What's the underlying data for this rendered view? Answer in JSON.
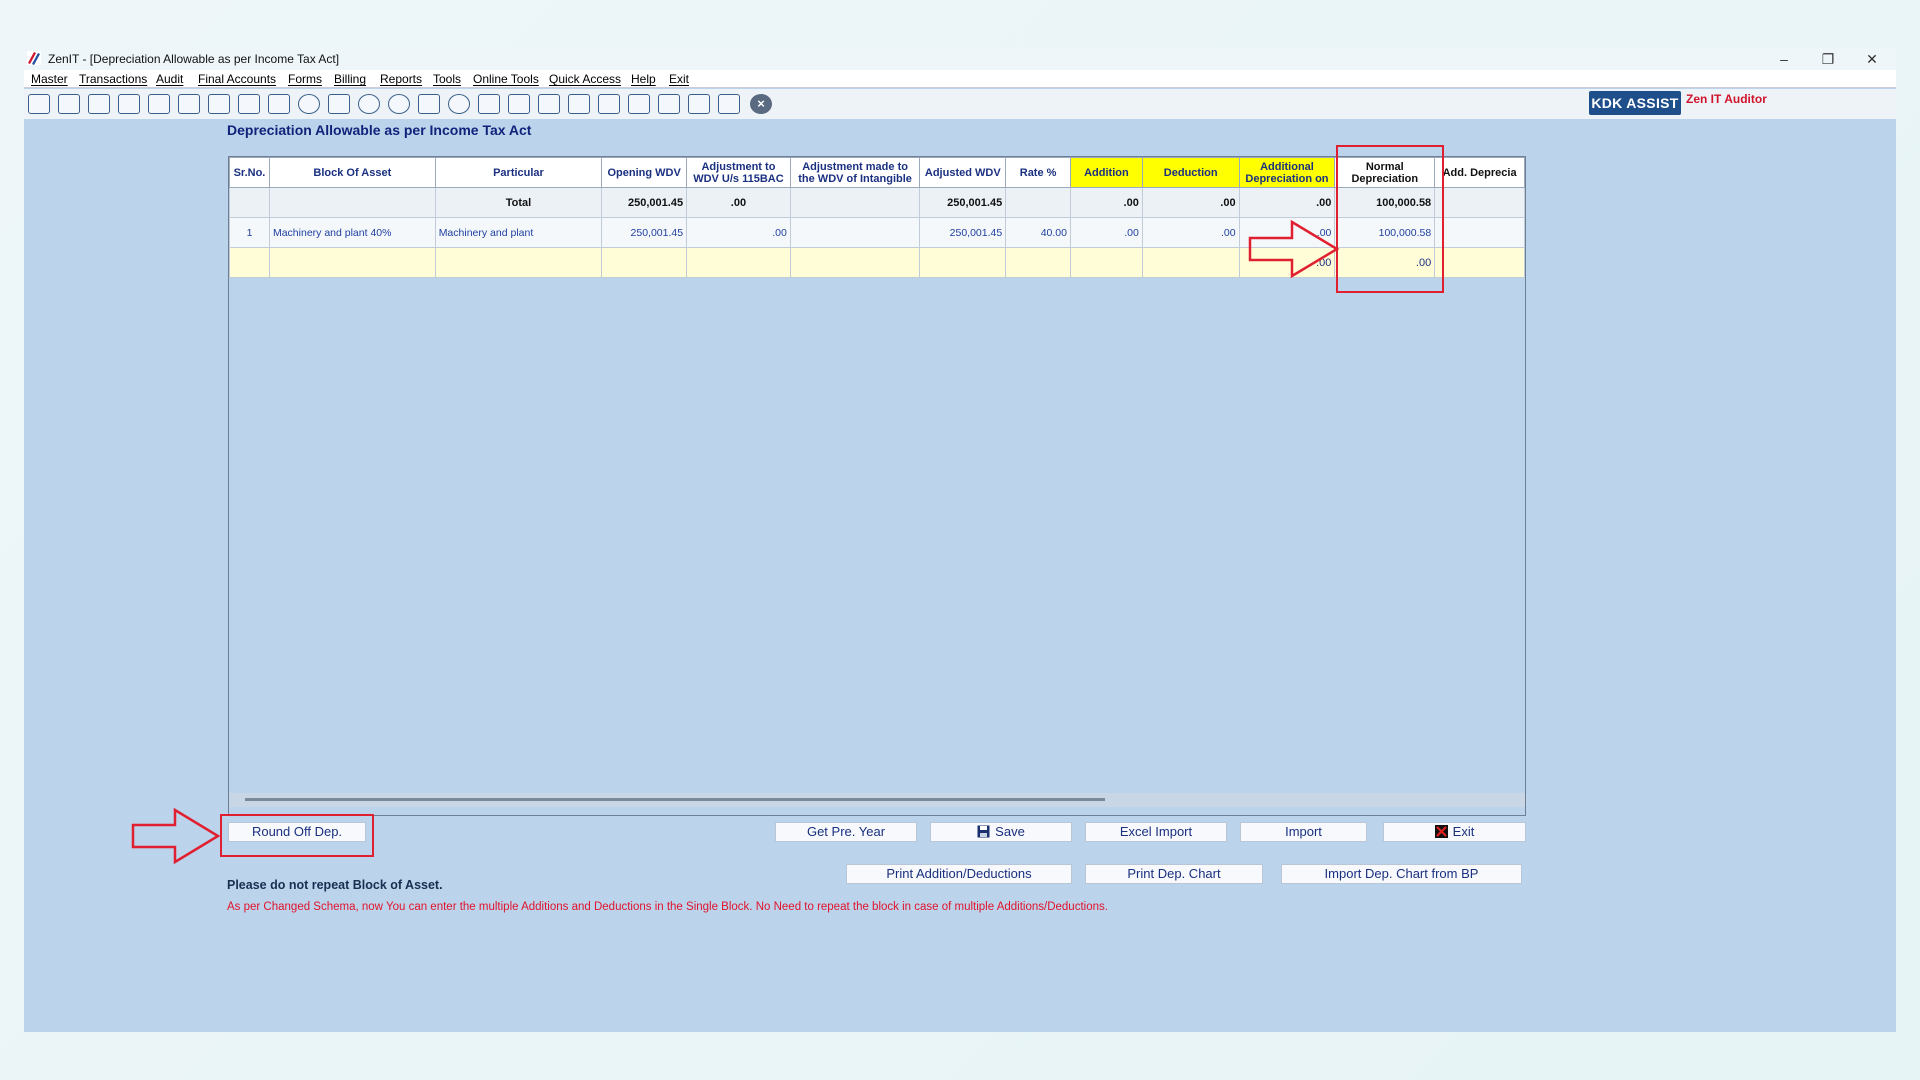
{
  "window": {
    "title": "ZenIT - [Depreciation Allowable as per Income Tax Act]",
    "controls": {
      "minimize": "–",
      "restore": "❐",
      "close": "✕"
    }
  },
  "menu": [
    "Master",
    "Transactions",
    "Audit",
    "Final Accounts",
    "Forms",
    "Billing",
    "Reports",
    "Tools",
    "Online Tools",
    "Quick Access",
    "Help",
    "Exit"
  ],
  "toolbar": {
    "icons": [
      "import-icon",
      "home-icon",
      "building-icon",
      "bar-chart-icon",
      "gift-icon",
      "users-icon",
      "tag-icon",
      "filter-icon",
      "tax-icon",
      "eye-icon",
      "calculator-icon",
      "pie-chart-icon",
      "payment-icon",
      "book-icon",
      "info-icon",
      "report-icon",
      "person-doc-icon",
      "calendar-icon",
      "refresh-icon",
      "copy-icon",
      "bs-icon",
      "database-icon",
      "tcd-icon",
      "layout-icon",
      "close-circle-icon"
    ],
    "kdk_assist": "KDK ASSIST",
    "zen_label": "Zen IT Auditor"
  },
  "page": {
    "title": "Depreciation Allowable as per Income Tax Act"
  },
  "table": {
    "headers": [
      "Sr.No.",
      "Block Of Asset",
      "Particular",
      "Opening WDV",
      "Adjustment to WDV U/s 115BAC",
      "Adjustment made to the WDV of Intangible",
      "Adjusted WDV",
      "Rate %",
      "Addition",
      "Deduction",
      "Additional Depreciation on",
      "Normal Depreciation",
      "Add. Deprecia"
    ],
    "total": {
      "label": "Total",
      "opening_wdv": "250,001.45",
      "adj_115bac": ".00",
      "adjusted_wdv": "250,001.45",
      "addition": ".00",
      "deduction": ".00",
      "additional_dep": ".00",
      "normal_dep": "100,000.58"
    },
    "rows": [
      {
        "sr": "1",
        "block": "Machinery and plant 40%",
        "particular": "Machinery and plant",
        "opening_wdv": "250,001.45",
        "adj_115bac": ".00",
        "adj_intangible": "",
        "adjusted_wdv": "250,001.45",
        "rate": "40.00",
        "addition": ".00",
        "deduction": ".00",
        "additional_dep": ".00",
        "normal_dep": "100,000.58"
      }
    ],
    "blank_row": {
      "additional_dep": ".00",
      "normal_dep": ".00"
    }
  },
  "buttons": {
    "round_off": "Round Off Dep.",
    "get_pre_year": "Get Pre. Year",
    "save": "Save",
    "excel_import": "Excel Import",
    "import": "Import",
    "exit": "Exit",
    "print_add_ded": "Print Addition/Deductions",
    "print_dep_chart": "Print Dep. Chart",
    "import_dep_chart_bp": "Import Dep. Chart from BP"
  },
  "notes": {
    "warning": "Please do not repeat Block of Asset.",
    "info": "As per Changed Schema, now You can enter the multiple Additions and Deductions in the Single Block. No Need to repeat the block in case of multiple Additions/Deductions."
  },
  "colors": {
    "accent": "#1f4f8b",
    "highlight": "#e02030",
    "yellow_header": "#ffff00",
    "background": "#bcd3ec"
  }
}
